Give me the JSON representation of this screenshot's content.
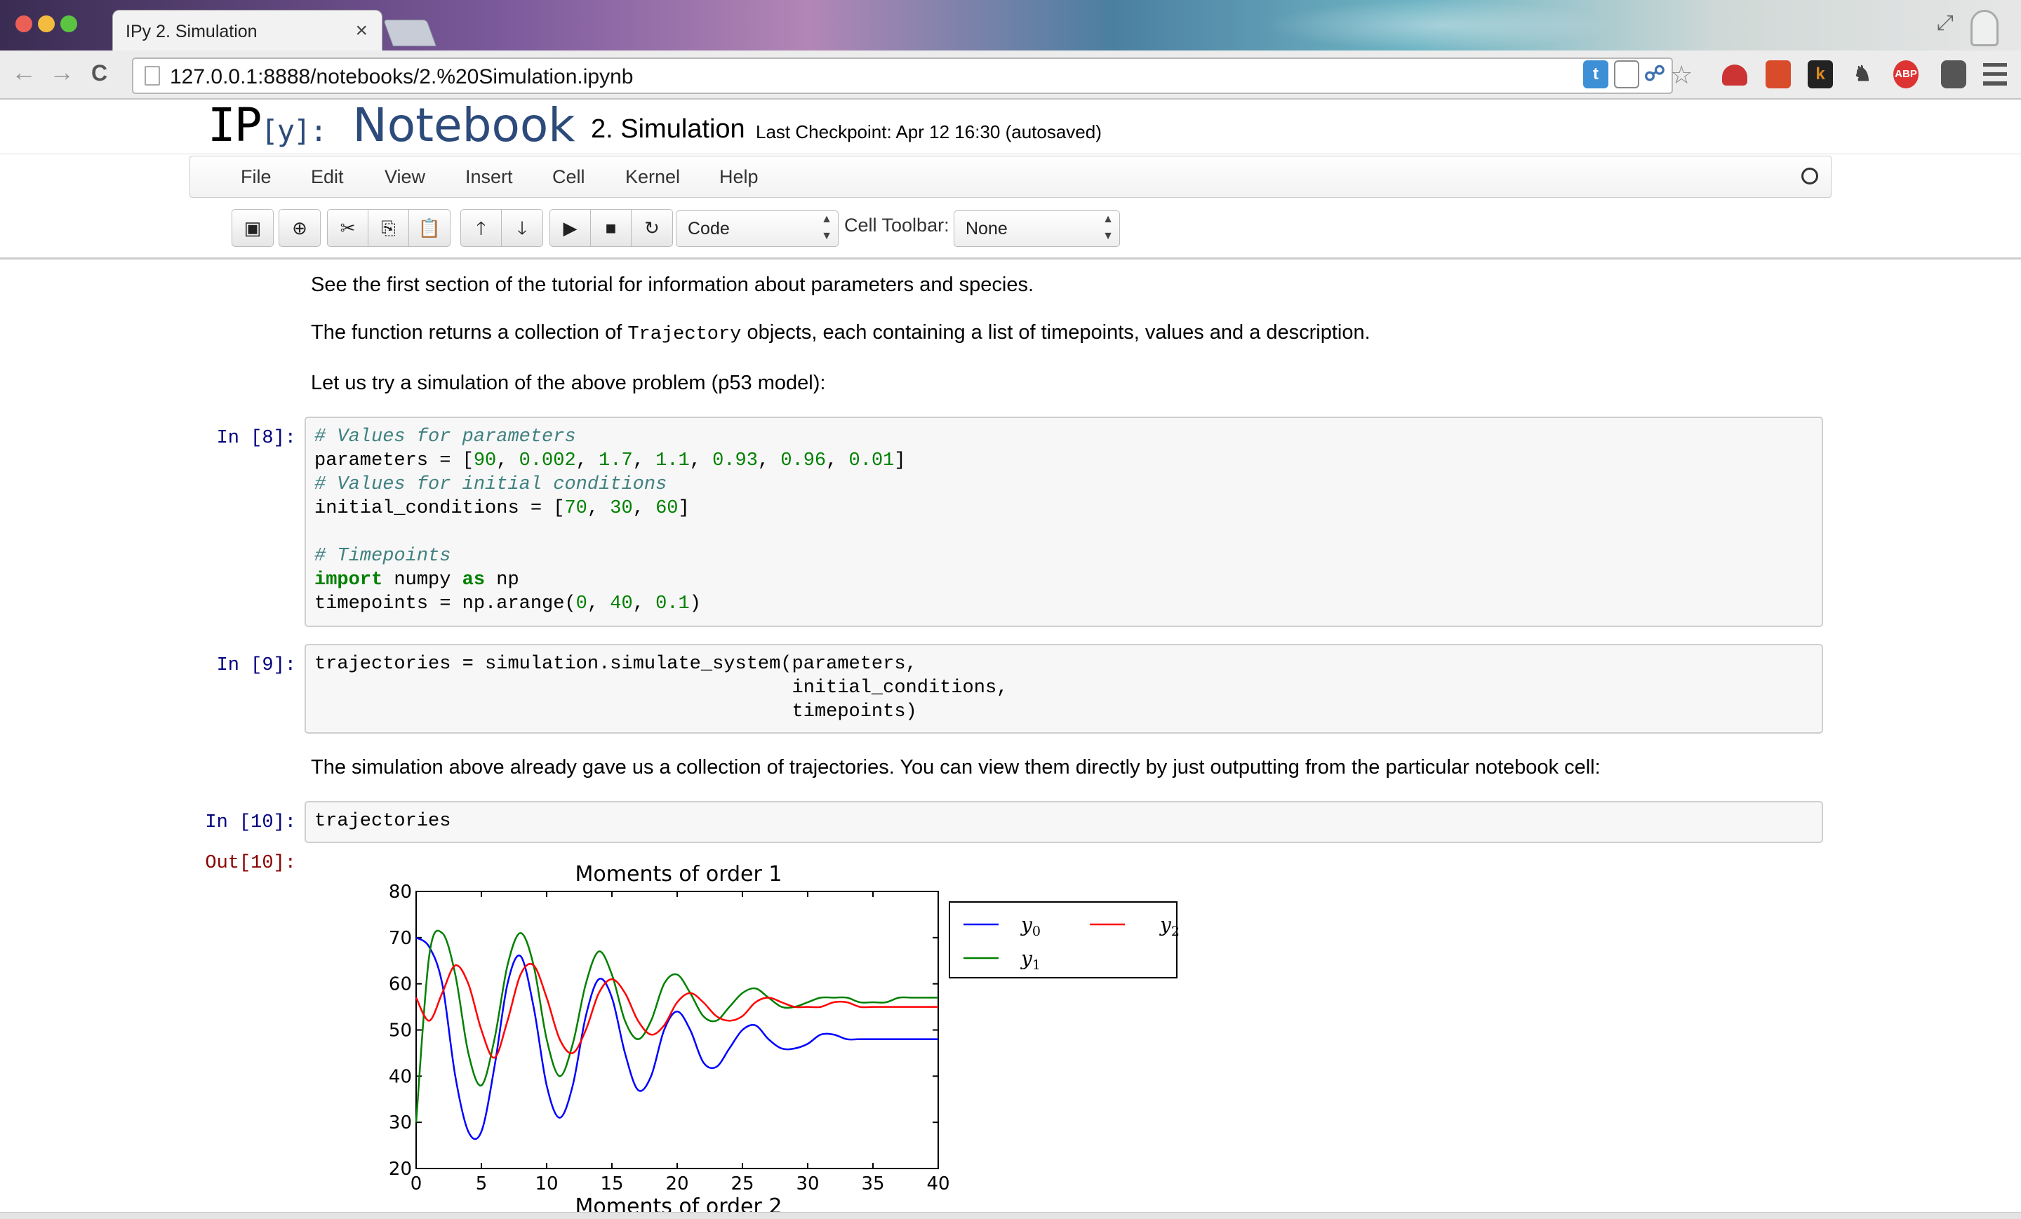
{
  "browser": {
    "tab_title": "IPy 2. Simulation",
    "tab_close": "×",
    "url": "127.0.0.1:8888/notebooks/2.%20Simulation.ipynb",
    "nav": {
      "back": "←",
      "forward": "→",
      "reload": "C"
    },
    "extensions": [
      {
        "name": "t-icon",
        "label": "t",
        "color": "#3d8fd6"
      },
      {
        "name": "k-icon",
        "label": "k",
        "color": "#e08a1e"
      },
      {
        "name": "abp-icon",
        "label": "ABP",
        "color": "#d33"
      }
    ]
  },
  "header": {
    "logo_ip": "IP",
    "logo_y": "[y]:",
    "logo_notebook": "Notebook",
    "notebook_title": "2. Simulation",
    "checkpoint": "Last Checkpoint: Apr 12 16:30 (autosaved)"
  },
  "menu": [
    "File",
    "Edit",
    "View",
    "Insert",
    "Cell",
    "Kernel",
    "Help"
  ],
  "toolbar": {
    "cell_type": "Code",
    "cell_toolbar_label": "Cell Toolbar:",
    "cell_toolbar_value": "None"
  },
  "markdown": {
    "p1": "See the first section of the tutorial for information about parameters and species.",
    "p2_before": "The function returns a collection of ",
    "p2_code": "Trajectory",
    "p2_after": " objects, each containing a list of timepoints, values and a description.",
    "p3": "Let us try a simulation of the above problem (p53 model):",
    "p4": "The simulation above already gave us a collection of trajectories. You can view them directly by just outputting from the particular notebook cell:"
  },
  "cells": {
    "c8_prompt": "In [8]:",
    "c8": {
      "l1": "# Values for parameters",
      "l2a": "parameters = [",
      "l2n": [
        "90",
        "0.002",
        "1.7",
        "1.1",
        "0.93",
        "0.96",
        "0.01"
      ],
      "l3": "# Values for initial conditions",
      "l4a": "initial_conditions = [",
      "l4n": [
        "70",
        "30",
        "60"
      ],
      "l6": "# Timepoints",
      "l7k1": "import",
      "l7m": " numpy ",
      "l7k2": "as",
      "l7e": " np",
      "l8a": "timepoints = np.arange(",
      "l8n": [
        "0",
        "40",
        "0.1"
      ]
    },
    "c9_prompt": "In [9]:",
    "c9": "trajectories = simulation.simulate_system(parameters,\n                                          initial_conditions,\n                                          timepoints)",
    "c10_prompt": "In [10]:",
    "c10": "trajectories",
    "out10_prompt": "Out[10]:"
  },
  "chart_data": [
    {
      "type": "line",
      "title": "Moments of order 1",
      "xlim": [
        0,
        40
      ],
      "ylim": [
        20,
        80
      ],
      "xticks": [
        "0",
        "5",
        "10",
        "15",
        "20",
        "25",
        "30",
        "35",
        "40"
      ],
      "yticks": [
        "20",
        "30",
        "40",
        "50",
        "60",
        "70",
        "80"
      ],
      "legend_position": "outside-right",
      "series": [
        {
          "name": "y0",
          "color": "#0000ff",
          "x": [
            0,
            1,
            2,
            3,
            4,
            5,
            6,
            7,
            8,
            9,
            10,
            11,
            12,
            13,
            14,
            15,
            16,
            17,
            18,
            19,
            20,
            21,
            22,
            23,
            24,
            25,
            26,
            27,
            28,
            29,
            30,
            31,
            32,
            33,
            34,
            35,
            36,
            37,
            38,
            39,
            40
          ],
          "y": [
            70,
            68,
            60,
            40,
            28,
            28,
            42,
            60,
            66,
            55,
            38,
            31,
            38,
            53,
            61,
            57,
            45,
            37,
            40,
            50,
            54,
            50,
            43,
            42,
            46,
            50,
            51,
            48,
            46,
            46,
            47,
            49,
            49,
            48,
            48,
            48,
            48,
            48,
            48,
            48,
            48
          ]
        },
        {
          "name": "y1",
          "color": "#008000",
          "x": [
            0,
            1,
            2,
            3,
            4,
            5,
            6,
            7,
            8,
            9,
            10,
            11,
            12,
            13,
            14,
            15,
            16,
            17,
            18,
            19,
            20,
            21,
            22,
            23,
            24,
            25,
            26,
            27,
            28,
            29,
            30,
            31,
            32,
            33,
            34,
            35,
            36,
            37,
            38,
            39,
            40
          ],
          "y": [
            30,
            66,
            71,
            62,
            45,
            38,
            48,
            64,
            71,
            64,
            48,
            40,
            47,
            60,
            67,
            62,
            52,
            48,
            52,
            60,
            62,
            58,
            53,
            52,
            55,
            58,
            59,
            57,
            55,
            55,
            56,
            57,
            57,
            57,
            56,
            56,
            56,
            57,
            57,
            57,
            57
          ]
        },
        {
          "name": "y2",
          "color": "#ff0000",
          "x": [
            0,
            1,
            2,
            3,
            4,
            5,
            6,
            7,
            8,
            9,
            10,
            11,
            12,
            13,
            14,
            15,
            16,
            17,
            18,
            19,
            20,
            21,
            22,
            23,
            24,
            25,
            26,
            27,
            28,
            29,
            30,
            31,
            32,
            33,
            34,
            35,
            36,
            37,
            38,
            39,
            40
          ],
          "y": [
            57,
            52,
            58,
            64,
            60,
            50,
            44,
            52,
            62,
            64,
            57,
            48,
            45,
            50,
            58,
            61,
            58,
            52,
            49,
            51,
            56,
            58,
            56,
            53,
            52,
            53,
            56,
            57,
            56,
            55,
            55,
            55,
            56,
            56,
            55,
            55,
            55,
            55,
            55,
            55,
            55
          ]
        }
      ]
    },
    {
      "type": "line",
      "title": "Moments of order 2"
    }
  ],
  "legend": [
    {
      "name": "y0",
      "base": "y",
      "sub": "0",
      "color": "#0000ff"
    },
    {
      "name": "y1",
      "base": "y",
      "sub": "1",
      "color": "#008000"
    },
    {
      "name": "y2",
      "base": "y",
      "sub": "2",
      "color": "#ff0000"
    }
  ]
}
